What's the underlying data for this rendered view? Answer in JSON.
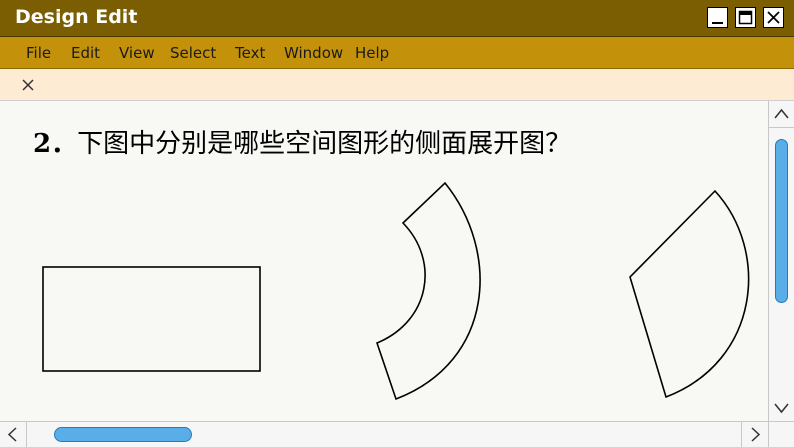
{
  "window": {
    "title": "Design Edit",
    "controls": [
      "minimize-icon",
      "maximize-icon",
      "close-icon"
    ]
  },
  "menu": {
    "items": [
      "File",
      "Edit",
      "View",
      "Select",
      "Text",
      "Window",
      "Help"
    ]
  },
  "tabstrip": {
    "close_icon": "close-icon"
  },
  "document": {
    "question_number": "2．",
    "question_text": "下图中分别是哪些空间图形的侧面展开图？",
    "figures": [
      "rectangle",
      "annular-sector",
      "circular-sector"
    ]
  },
  "scrollbars": {
    "thumb_color": "#5aaee8",
    "vertical_position": 0.0,
    "horizontal_position": 0.0
  },
  "colors": {
    "titlebar": "#7c5e02",
    "menubar": "#c4920a",
    "tabstrip": "#fdebd3",
    "canvas": "#f8f8f5"
  }
}
